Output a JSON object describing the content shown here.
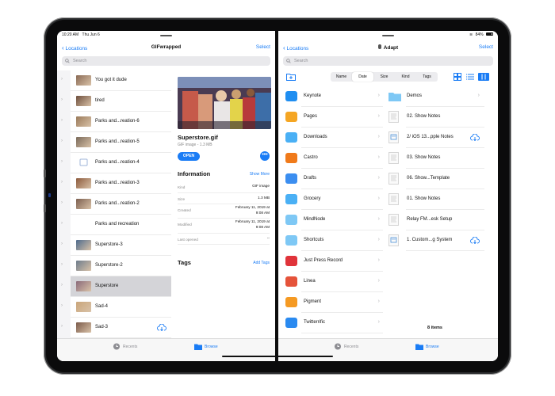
{
  "colors": {
    "accent": "#1a7cf5",
    "selected_row": "#d4d4d8",
    "device": "#2b2c2e"
  },
  "left": {
    "status": {
      "time": "10:20 AM",
      "date": "Thu Jun 6"
    },
    "nav": {
      "back": "Locations",
      "title": "GIFwrapped",
      "action": "Select"
    },
    "search": {
      "placeholder": "Search"
    },
    "items": [
      {
        "name": "You got it dude",
        "thumb": "#8a6a55",
        "selected": false
      },
      {
        "name": "tired",
        "thumb": "#6d4e3c",
        "selected": false
      },
      {
        "name": "Parks and...reation-6",
        "thumb": "#9a7a5a",
        "selected": false
      },
      {
        "name": "Parks and...reation-5",
        "thumb": "#7a6a5a",
        "selected": false
      },
      {
        "name": "Parks and...reation-4",
        "thumb": "icon",
        "selected": false
      },
      {
        "name": "Parks and...reation-3",
        "thumb": "#8c5a3c",
        "selected": false
      },
      {
        "name": "Parks and...reation-2",
        "thumb": "#7b5e4e",
        "selected": false
      },
      {
        "name": "Parks and recreation",
        "thumb": "none",
        "selected": false
      },
      {
        "name": "Superstore-3",
        "thumb": "#4d6a8c",
        "selected": false
      },
      {
        "name": "Superstore-2",
        "thumb": "#6d7c8c",
        "selected": false
      },
      {
        "name": "Superstore",
        "thumb": "#8a6a7a",
        "selected": true
      },
      {
        "name": "Sad-4",
        "thumb": "#c9a57a",
        "selected": false
      },
      {
        "name": "Sad-3",
        "thumb": "#7a5a4a",
        "selected": false,
        "cloud": true
      }
    ],
    "detail": {
      "title": "Superstore.gif",
      "subtitle": "GIF image - 1.3 MB",
      "open": "OPEN",
      "more": "•••",
      "info_heading": "Information",
      "show_more": "Show More",
      "info": [
        {
          "key": "Kind",
          "value": "GIF image"
        },
        {
          "key": "Size",
          "value": "1.3 MB"
        },
        {
          "key": "Created",
          "value": "February 11, 2019 at 9:08 AM"
        },
        {
          "key": "Modified",
          "value": "February 11, 2019 at 9:08 AM"
        },
        {
          "key": "Last opened",
          "value": "--"
        }
      ],
      "tags_heading": "Tags",
      "add_tags": "Add Tags"
    },
    "tabbar": {
      "recents": "Recents",
      "browse": "Browse"
    }
  },
  "right": {
    "status": {
      "battery": "84%"
    },
    "nav": {
      "back": "Locations",
      "title": "Adapt",
      "action": "Select"
    },
    "search": {
      "placeholder": "Search"
    },
    "sort": [
      "Name",
      "Date",
      "Size",
      "Kind",
      "Tags"
    ],
    "sort_active": "Date",
    "locations": [
      {
        "name": "Keynote",
        "icon_color": "#1f8ef1"
      },
      {
        "name": "Pages",
        "icon_color": "#f5a623"
      },
      {
        "name": "Downloads",
        "icon_color": "#4ab0f5"
      },
      {
        "name": "Castro",
        "icon_color": "#f07a1a"
      },
      {
        "name": "Drafts",
        "icon_color": "#3b8ef0"
      },
      {
        "name": "Grocery",
        "icon_color": "#4ab0f5"
      },
      {
        "name": "MindNode",
        "icon_color": "#7ec8f5"
      },
      {
        "name": "Shortcuts",
        "icon_color": "#7ec8f5"
      },
      {
        "name": "Just Press Record",
        "icon_color": "#e0333a"
      },
      {
        "name": "Linea",
        "icon_color": "#e5533a"
      },
      {
        "name": "Pigment",
        "icon_color": "#f59a23"
      },
      {
        "name": "Twitterrific",
        "icon_color": "#2a8af0"
      }
    ],
    "files": [
      {
        "name": "Demos",
        "type": "folder",
        "end": "chevron"
      },
      {
        "name": "02. Show Notes",
        "type": "doc",
        "end": ""
      },
      {
        "name": "2/ iOS 13...pple Notes",
        "type": "note",
        "end": "cloud"
      },
      {
        "name": "03. Show Notes",
        "type": "doc",
        "end": ""
      },
      {
        "name": "06. Show...Template",
        "type": "doc",
        "end": ""
      },
      {
        "name": "01. Show Notes",
        "type": "doc",
        "end": ""
      },
      {
        "name": "Relay FM...esk Setup",
        "type": "doc",
        "end": ""
      },
      {
        "name": "1. Custom...g System",
        "type": "note",
        "end": "cloud"
      }
    ],
    "count": "8 items",
    "tabbar": {
      "recents": "Recents",
      "browse": "Browse"
    }
  }
}
